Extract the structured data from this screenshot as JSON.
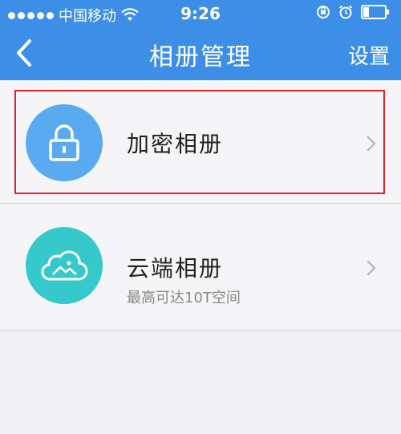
{
  "status_bar": {
    "carrier": "中国移动",
    "time": "9:26"
  },
  "nav": {
    "title": "相册管理",
    "right_action": "设置"
  },
  "items": [
    {
      "title": "加密相册",
      "icon": "lock-icon"
    },
    {
      "title": "云端相册",
      "subtitle": "最高可达10T空间",
      "icon": "cloud-image-icon"
    }
  ],
  "colors": {
    "header": "#3c8ee6",
    "encrypted_icon_bg": "#5aaaf2",
    "cloud_icon_bg": "#36c9cc",
    "highlight": "#d9232e"
  }
}
